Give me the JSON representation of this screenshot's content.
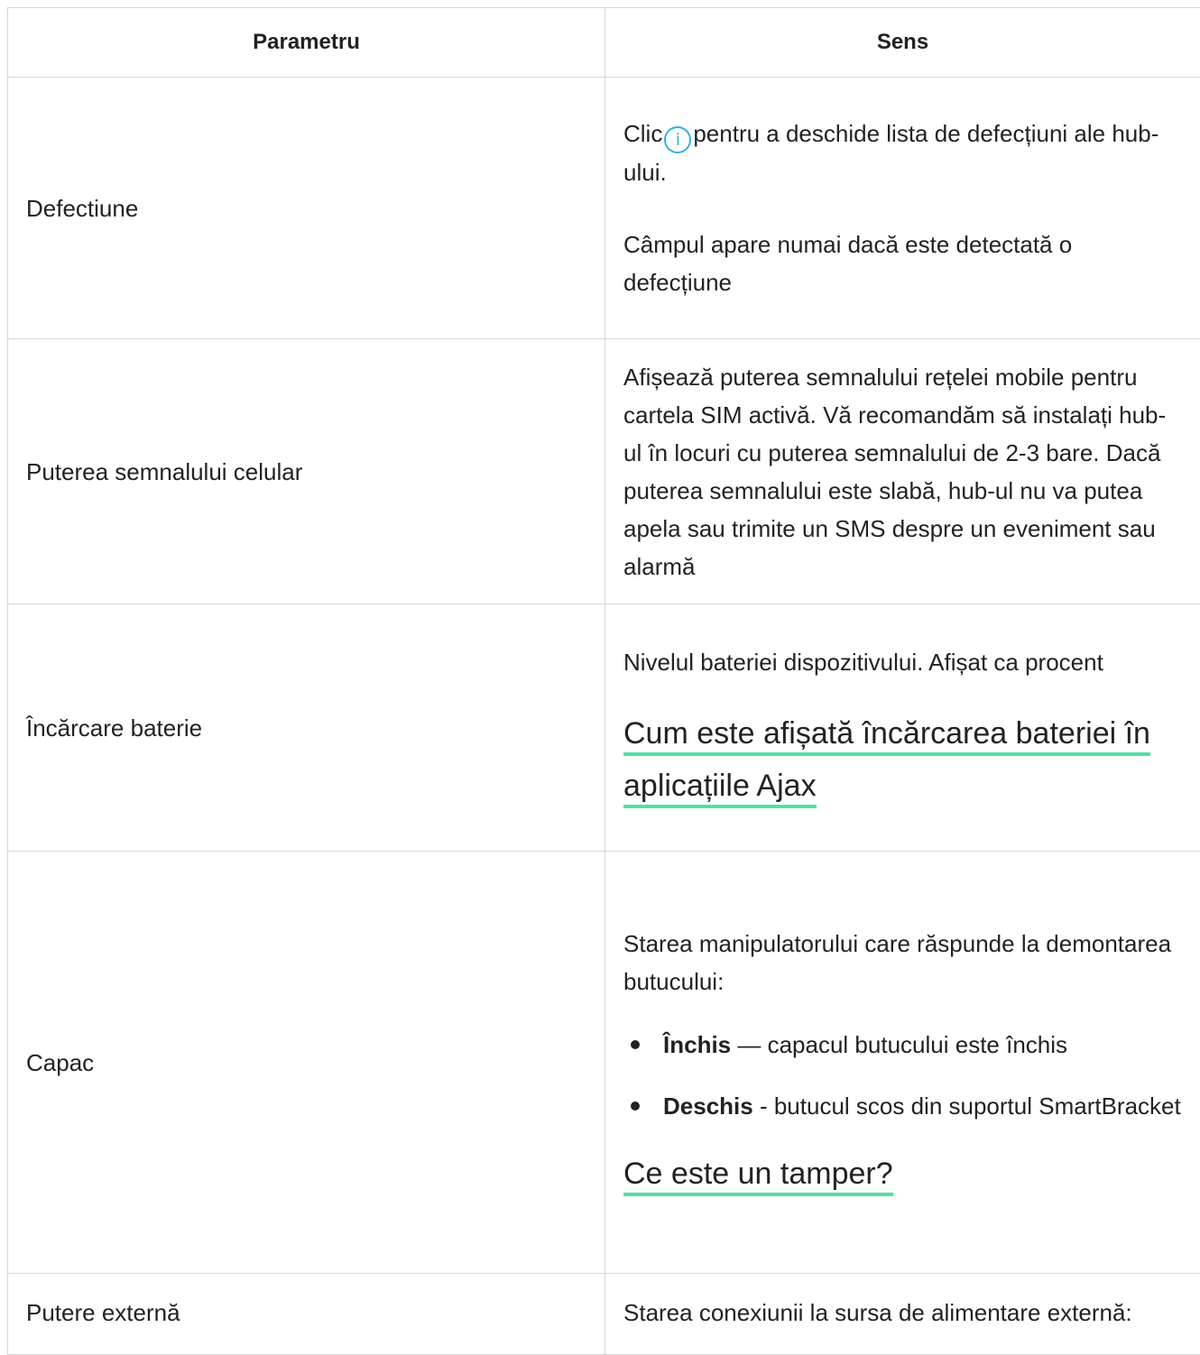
{
  "table": {
    "headers": [
      "Parametru",
      "Sens"
    ],
    "rows": [
      {
        "param": "Defectiune",
        "value_prefix": "Clic",
        "value_suffix": "pentru a deschide lista de defecțiuni ale hub-ului.",
        "value_note": "Câmpul apare numai dacă este detectată o defecțiune",
        "icon": "info-icon"
      },
      {
        "param": "Puterea semnalului celular",
        "value": "Afișează puterea semnalului rețelei mobile pentru cartela SIM activă. Vă recomandăm să instalați hub-ul în locuri cu puterea semnalului de 2-3 bare. Dacă puterea semnalului este slabă, hub-ul nu va putea apela sau trimite un SMS despre un eveniment sau alarmă"
      },
      {
        "param": "Încărcare baterie",
        "value": "Nivelul bateriei dispozitivului. Afișat ca procent",
        "link": "Cum este afișată încărcarea bateriei în aplicațiile Ajax"
      },
      {
        "param": "Capac",
        "value": "Starea manipulatorului care răspunde la demontarea butucului:",
        "items": [
          {
            "bold": "Închis",
            "text": " — capacul butucului este închis"
          },
          {
            "bold": "Deschis",
            "text": " - butucul scos din suportul SmartBracket"
          }
        ],
        "link": "Ce este un tamper?"
      },
      {
        "param": "Putere externă",
        "value": "Starea conexiunii la sursa de alimentare externă:"
      }
    ]
  },
  "colors": {
    "border": "#d6d6d6",
    "link_underline": "#4ee2a4",
    "icon": "#2bb3e8"
  }
}
